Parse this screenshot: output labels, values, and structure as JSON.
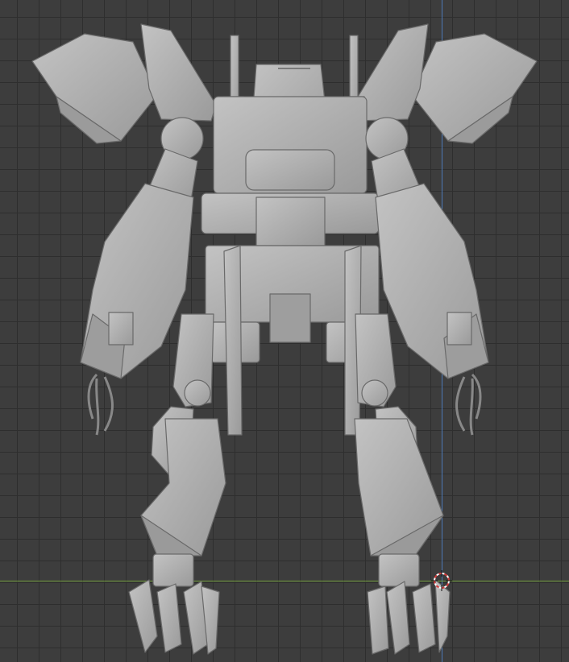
{
  "app": "3D viewport",
  "view": {
    "type": "orthographic back view",
    "background_color": "#3d3d3d",
    "grid_color": "#2e2e2e",
    "axis_colors": {
      "z": "#4c79b6",
      "x": "#6f9a3a"
    }
  },
  "object": {
    "name_visible": false,
    "material_color": "#a9a9a9",
    "shade_dark": "#8c8c8c",
    "shade_light": "#c2c2c2"
  },
  "icons": [
    "3d-cursor-icon"
  ]
}
